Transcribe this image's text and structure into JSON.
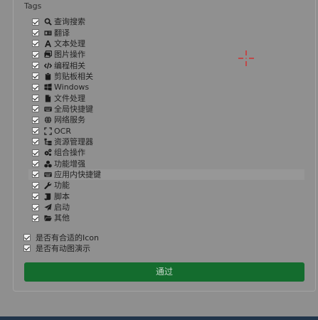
{
  "section": {
    "title": "Tags"
  },
  "tags": [
    {
      "icon": "search-icon",
      "label": "查询搜索",
      "checked": true
    },
    {
      "icon": "language-icon",
      "label": "翻译",
      "checked": true
    },
    {
      "icon": "font-icon",
      "label": "文本处理",
      "checked": true
    },
    {
      "icon": "images-icon",
      "label": "图片操作",
      "checked": true
    },
    {
      "icon": "code-icon",
      "label": "编程相关",
      "checked": true
    },
    {
      "icon": "clipboard-icon",
      "label": "剪贴板相关",
      "checked": true
    },
    {
      "icon": "windows-icon",
      "label": "Windows",
      "checked": true
    },
    {
      "icon": "file-icon",
      "label": "文件处理",
      "checked": true
    },
    {
      "icon": "keyboard-icon",
      "label": "全局快捷键",
      "checked": true
    },
    {
      "icon": "globe-icon",
      "label": "网络服务",
      "checked": true
    },
    {
      "icon": "scan-icon",
      "label": "OCR",
      "checked": true
    },
    {
      "icon": "folder-tree-icon",
      "label": "资源管理器",
      "checked": true
    },
    {
      "icon": "cogs-icon",
      "label": "组合操作",
      "checked": true
    },
    {
      "icon": "cubes-icon",
      "label": "功能增强",
      "checked": true
    },
    {
      "icon": "keyboard-icon",
      "label": "应用内快捷键",
      "checked": true
    },
    {
      "icon": "wrench-icon",
      "label": "功能",
      "checked": true
    },
    {
      "icon": "scroll-icon",
      "label": "脚本",
      "checked": true
    },
    {
      "icon": "paper-plane-icon",
      "label": "启动",
      "checked": true
    },
    {
      "icon": "folder-open-icon",
      "label": "其他",
      "checked": true
    }
  ],
  "extra_options": [
    {
      "label": "是否有合适的Icon",
      "checked": true
    },
    {
      "label": "是否有动图演示",
      "checked": true
    }
  ],
  "submit_button": {
    "label": "通过"
  },
  "colors": {
    "submit_bg": "#146c2e",
    "crosshair": "#e01919",
    "bottom_bar": "#21354a"
  }
}
